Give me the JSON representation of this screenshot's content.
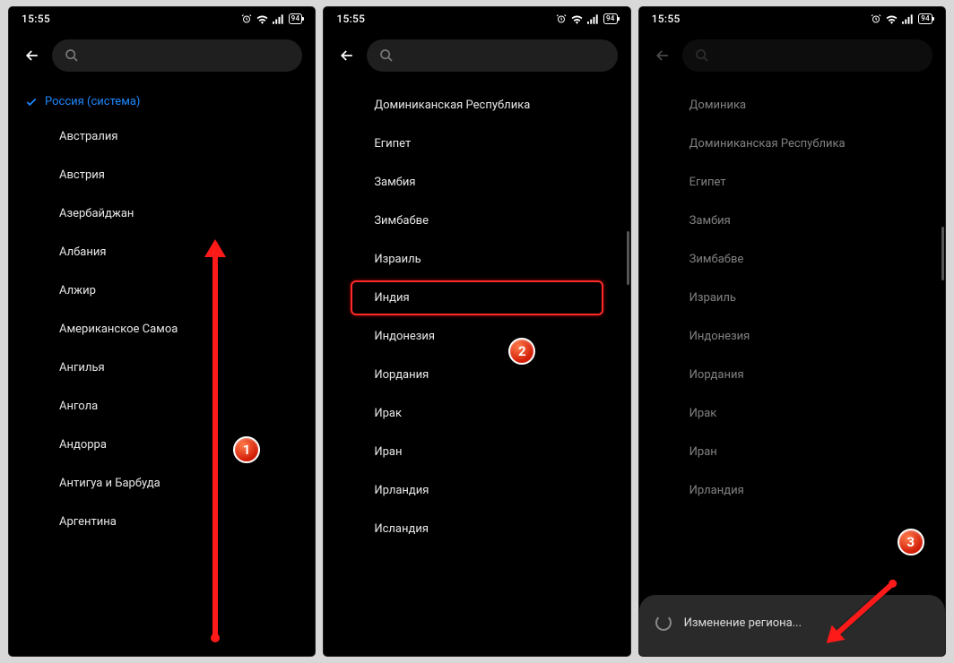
{
  "status": {
    "time": "15:55",
    "battery": "94"
  },
  "screens": [
    {
      "selected": "Россия (система)",
      "items": [
        "Австралия",
        "Австрия",
        "Азербайджан",
        "Албания",
        "Алжир",
        "Американское Самоа",
        "Ангилья",
        "Ангола",
        "Андорра",
        "Антигуа и Барбуда",
        "Аргентина"
      ]
    },
    {
      "items": [
        "Доминиканская Республика",
        "Египет",
        "Замбия",
        "Зимбабве",
        "Израиль",
        "Индия",
        "Индонезия",
        "Иордания",
        "Ирак",
        "Иран",
        "Ирландия",
        "Исландия"
      ],
      "highlight_index": 5
    },
    {
      "items": [
        "Доминика",
        "Доминиканская Республика",
        "Египет",
        "Замбия",
        "Зимбабве",
        "Израиль",
        "Индонезия",
        "Иордания",
        "Ирак",
        "Иран",
        "Ирландия"
      ],
      "toast": "Изменение региона..."
    }
  ],
  "annotations": {
    "b1": "1",
    "b2": "2",
    "b3": "3"
  }
}
